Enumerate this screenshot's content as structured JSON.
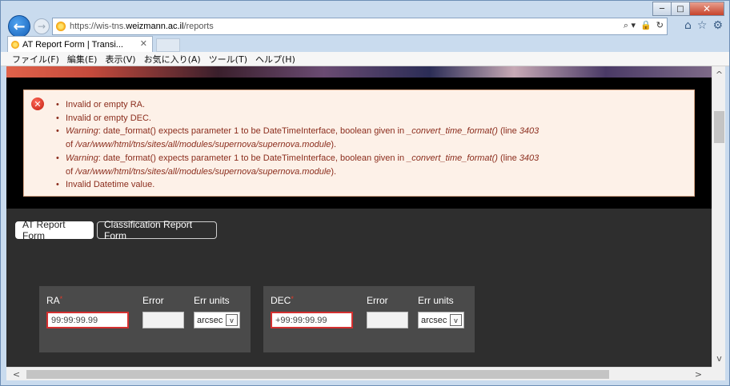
{
  "window": {
    "minimize": "─",
    "maximize": "□",
    "close": "✕"
  },
  "nav": {
    "back_icon": "←",
    "forward_icon": "→",
    "url_prefix": "https://wis-tns.",
    "url_domain": "weizmann.ac.il",
    "url_path": "/reports",
    "addr_icons": [
      "⌕ ▾",
      "🔒",
      "↻"
    ],
    "toolbar_icons": [
      "⌂",
      "☆",
      "⚙"
    ]
  },
  "tab": {
    "title": "AT Report Form | Transi...",
    "close": "✕"
  },
  "menu": [
    "ファイル(F)",
    "編集(E)",
    "表示(V)",
    "お気に入り(A)",
    "ツール(T)",
    "ヘルプ(H)"
  ],
  "errors": {
    "icon": "✕",
    "items": [
      {
        "type": "plain",
        "text": "Invalid or empty RA."
      },
      {
        "type": "plain",
        "text": "Invalid or empty DEC."
      },
      {
        "type": "warning",
        "label": "Warning",
        "text": ": date_format() expects parameter 1 to be DateTimeInterface, boolean given in ",
        "func": "_convert_time_format()",
        "line_pre": " (line ",
        "line": "3403",
        "cont_pre": "of ",
        "path": "/var/www/html/tns/sites/all/modules/supernova/supernova.module",
        "cont_post": ")."
      },
      {
        "type": "warning",
        "label": "Warning",
        "text": ": date_format() expects parameter 1 to be DateTimeInterface, boolean given in ",
        "func": "_convert_time_format()",
        "line_pre": " (line ",
        "line": "3403",
        "cont_pre": "of ",
        "path": "/var/www/html/tns/sites/all/modules/supernova/supernova.module",
        "cont_post": ")."
      },
      {
        "type": "plain",
        "text": "Invalid Datetime value."
      }
    ]
  },
  "form_tabs": {
    "active": "AT Report Form",
    "inactive": "Classification Report Form"
  },
  "ra_group": {
    "label": "RA",
    "required": "*",
    "value": "99:99:99.99",
    "error_label": "Error",
    "units_label": "Err units",
    "units_value": "arcsec"
  },
  "dec_group": {
    "label": "DEC",
    "required": "*",
    "value": "+99:99:99.99",
    "error_label": "Error",
    "units_label": "Err units",
    "units_value": "arcsec"
  },
  "scroll": {
    "up": "^",
    "down": "v",
    "left": "<",
    "right": ">"
  }
}
